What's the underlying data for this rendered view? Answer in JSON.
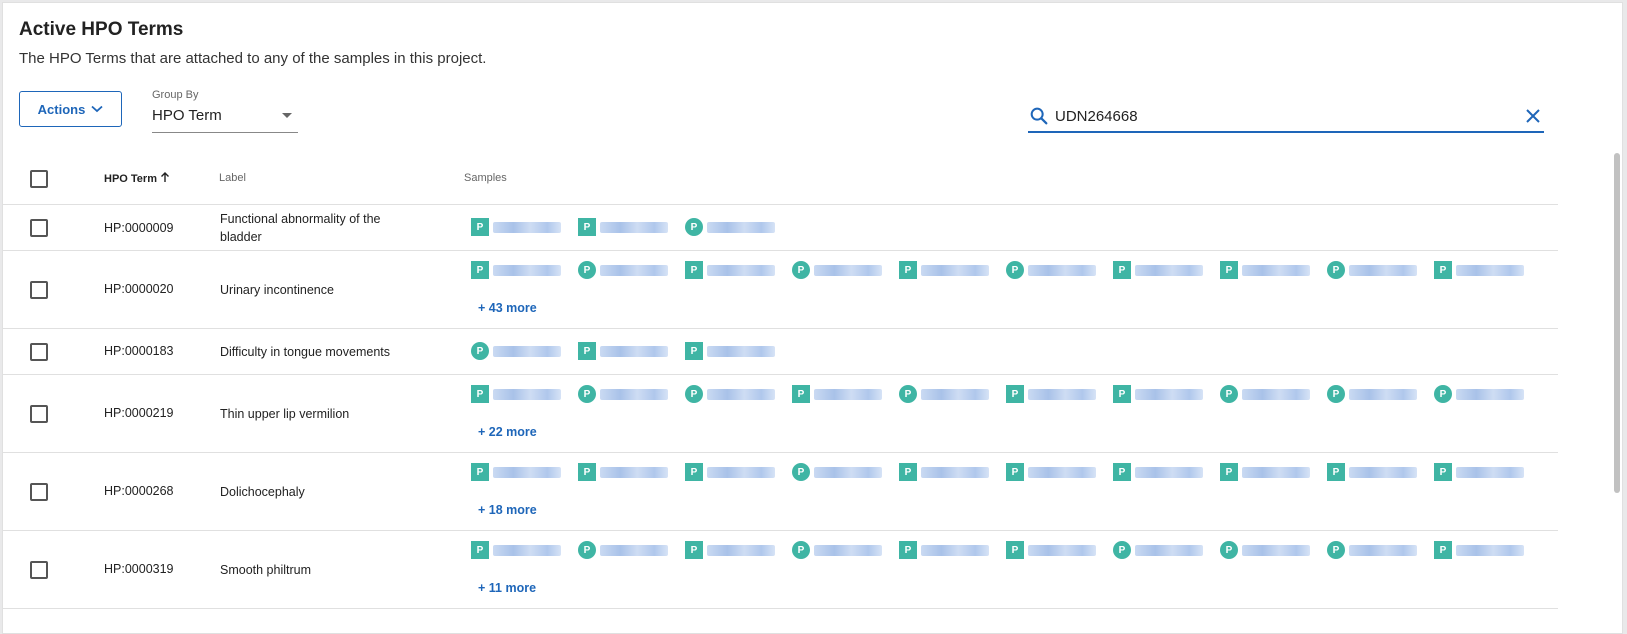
{
  "header": {
    "title": "Active HPO Terms",
    "subtitle": "The HPO Terms that are attached to any of the samples in this project."
  },
  "toolbar": {
    "actions_label": "Actions",
    "group_by_label": "Group By",
    "group_by_value": "HPO Term",
    "search_value": "UDN264668"
  },
  "table": {
    "columns": {
      "term": "HPO Term",
      "label": "Label",
      "samples": "Samples"
    },
    "sort": {
      "column": "HPO Term",
      "direction": "ascending"
    },
    "badge_letter": "P",
    "rows": [
      {
        "term": "HP:0000009",
        "label": "Functional abnormality of the bladder",
        "shapes": [
          "square",
          "square",
          "round"
        ],
        "more": ""
      },
      {
        "term": "HP:0000020",
        "label": "Urinary incontinence",
        "shapes": [
          "square",
          "round",
          "square",
          "round",
          "square",
          "round",
          "square",
          "square",
          "round",
          "square"
        ],
        "more": "+ 43 more"
      },
      {
        "term": "HP:0000183",
        "label": "Difficulty in tongue movements",
        "shapes": [
          "round",
          "square",
          "square"
        ],
        "more": ""
      },
      {
        "term": "HP:0000219",
        "label": "Thin upper lip vermilion",
        "shapes": [
          "square",
          "round",
          "round",
          "square",
          "round",
          "square",
          "square",
          "round",
          "round",
          "round"
        ],
        "more": "+ 22 more"
      },
      {
        "term": "HP:0000268",
        "label": "Dolichocephaly",
        "shapes": [
          "square",
          "square",
          "square",
          "round",
          "square",
          "square",
          "square",
          "square",
          "square",
          "square"
        ],
        "more": "+ 18 more"
      },
      {
        "term": "HP:0000319",
        "label": "Smooth philtrum",
        "shapes": [
          "square",
          "round",
          "square",
          "round",
          "square",
          "square",
          "round",
          "round",
          "round",
          "square"
        ],
        "more": "+ 11 more"
      }
    ]
  },
  "colors": {
    "accent": "#1e66b9",
    "badge": "#3fb5a4"
  }
}
